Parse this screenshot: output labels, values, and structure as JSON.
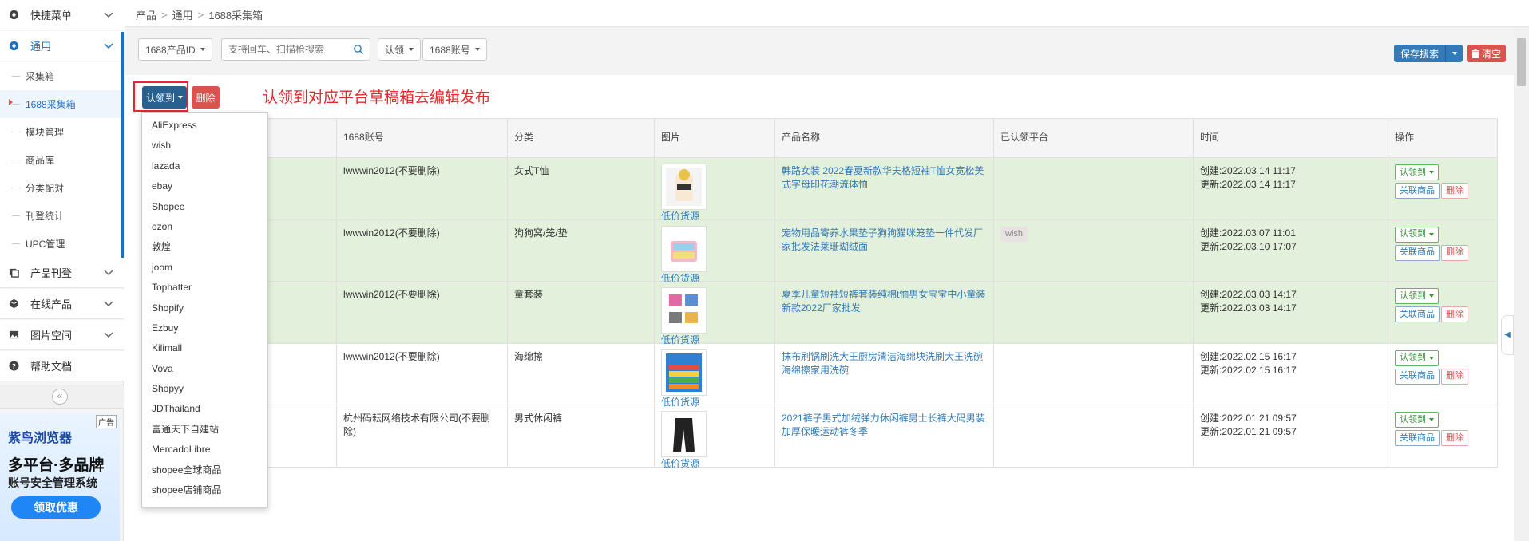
{
  "sidebar": {
    "menus": [
      {
        "label": "快捷菜单",
        "icon": "gear-icon"
      },
      {
        "label": "通用",
        "icon": "gear-icon",
        "active": true
      },
      {
        "label": "产品刊登",
        "icon": "stack-icon"
      },
      {
        "label": "在线产品",
        "icon": "cube-icon"
      },
      {
        "label": "图片空间",
        "icon": "image-icon"
      },
      {
        "label": "帮助文档",
        "icon": "help-icon"
      }
    ],
    "submenu": [
      {
        "label": "采集箱"
      },
      {
        "label": "1688采集箱",
        "active": true
      },
      {
        "label": "模块管理"
      },
      {
        "label": "商品库"
      },
      {
        "label": "分类配对"
      },
      {
        "label": "刊登统计"
      },
      {
        "label": "UPC管理"
      }
    ],
    "collapse_icon": "«",
    "ad": {
      "tag": "广告",
      "brand": "紫鸟浏览器",
      "title": "多平台·多品牌",
      "subtitle": "账号安全管理系统",
      "button": "领取优惠"
    }
  },
  "breadcrumb": [
    "产品",
    "通用",
    "1688采集箱"
  ],
  "filters": {
    "product_id": "1688产品ID",
    "search_placeholder": "支持回车、扫描枪搜索",
    "claim": "认领",
    "account": "1688账号"
  },
  "toolbar": {
    "save_search": "保存搜索",
    "clear": "清空",
    "claim_to": "认领到",
    "delete": "删除",
    "annotation": "认领到对应平台草稿箱去编辑发布"
  },
  "table": {
    "headers": [
      "1688账号",
      "分类",
      "图片",
      "产品名称",
      "已认领平台",
      "时间",
      "操作"
    ],
    "source_link": "低价货源",
    "op_claim": "认领到",
    "op_link": "关联商品",
    "op_delete": "删除",
    "rows": [
      {
        "account": "lwwwin2012(不要删除)",
        "category": "女式T恤",
        "name": "韩路女装 2022春夏新款华夫格短袖T恤女宽松美式字母印花潮流体恤",
        "platform": "",
        "created": "创建:2022.03.14 11:17",
        "updated": "更新:2022.03.14 11:17",
        "highlight": true
      },
      {
        "account": "lwwwin2012(不要删除)",
        "category": "狗狗窝/笼/垫",
        "name": "宠物用品寄养水果垫子狗狗猫咪笼垫一件代发厂家批发法莱珊瑚绒面",
        "platform": "wish",
        "created": "创建:2022.03.07 11:01",
        "updated": "更新:2022.03.10 17:07",
        "highlight": true
      },
      {
        "account": "lwwwin2012(不要删除)",
        "category": "童套装",
        "name": "夏季儿童短袖短裤套装纯棉t恤男女宝宝中小童装新款2022厂家批发",
        "platform": "",
        "created": "创建:2022.03.03 14:17",
        "updated": "更新:2022.03.03 14:17",
        "highlight": true
      },
      {
        "account": "lwwwin2012(不要删除)",
        "category": "海绵擦",
        "name": "抹布刷锅刷洗大王厨房清洁海绵块洗刷大王洗碗海绵擦家用洗碗",
        "platform": "",
        "created": "创建:2022.02.15 16:17",
        "updated": "更新:2022.02.15 16:17",
        "highlight": false
      },
      {
        "account": "杭州码耘网络技术有限公司(不要删除)",
        "category": "男式休闲裤",
        "name": "2021裤子男式加绒弹力休闲裤男士长裤大码男装加厚保暖运动裤冬季",
        "platform": "",
        "created": "创建:2022.01.21 09:57",
        "updated": "更新:2022.01.21 09:57",
        "highlight": false
      }
    ]
  },
  "dropdown": [
    "AliExpress",
    "wish",
    "lazada",
    "ebay",
    "Shopee",
    "ozon",
    "敦煌",
    "joom",
    "Tophatter",
    "Shopify",
    "Ezbuy",
    "Kilimall",
    "Vova",
    "Shopyy",
    "JDThailand",
    "富通天下自建站",
    "MercadoLibre",
    "shopee全球商品",
    "shopee店铺商品"
  ],
  "colors": {
    "primary": "#337ab7",
    "danger": "#d9534f",
    "highlight_row": "#e3f1dc",
    "annotation": "#e8262b"
  }
}
